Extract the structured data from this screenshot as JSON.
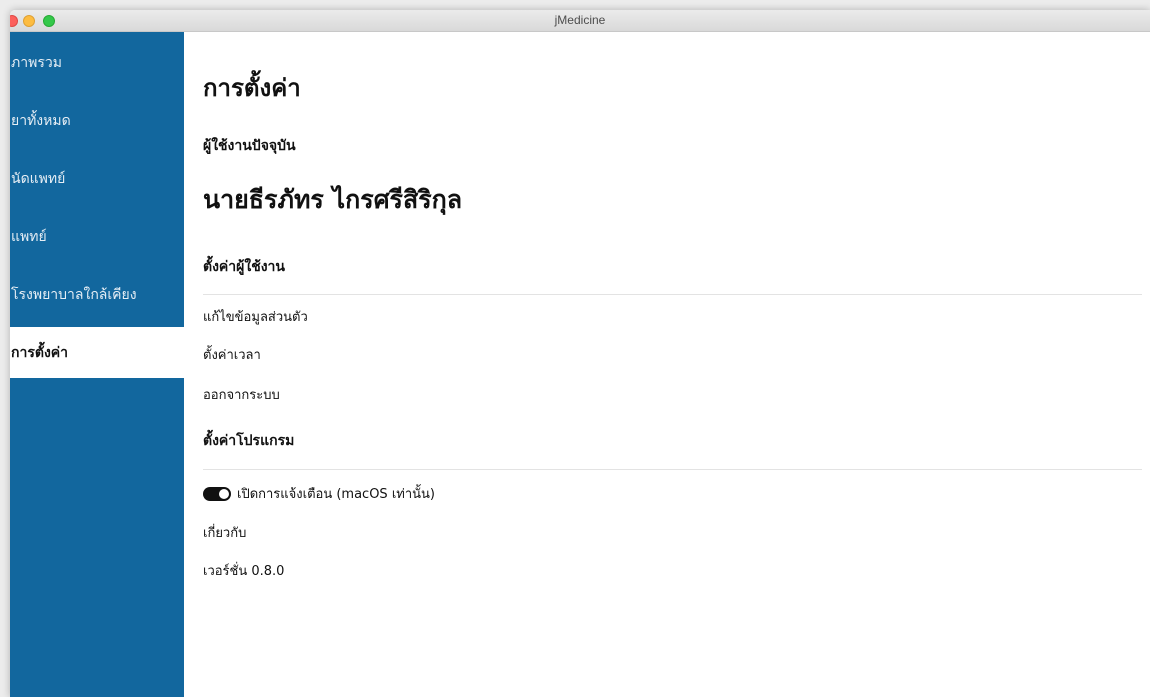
{
  "window": {
    "title": "jMedicine"
  },
  "sidebar": {
    "items": [
      {
        "label": "ภาพรวม"
      },
      {
        "label": "ยาทั้งหมด"
      },
      {
        "label": "นัดแพทย์"
      },
      {
        "label": "แพทย์"
      },
      {
        "label": "โรงพยาบาลใกล้เคียง"
      },
      {
        "label": "การตั้งค่า",
        "active": true
      }
    ]
  },
  "main": {
    "title": "การตั้งค่า",
    "current_user_label": "ผู้ใช้งานปัจจุบัน",
    "user_name": "นายธีรภัทร ไกรศรีสิริกุล",
    "user_settings": {
      "heading": "ตั้งค่าผู้ใช้งาน",
      "links": [
        "แก้ไขข้อมูลส่วนตัว",
        "ตั้งค่าเวลา",
        "ออกจากระบบ"
      ]
    },
    "program_settings": {
      "heading": "ตั้งค่าโปรแกรม",
      "notification_toggle": {
        "label": "เปิดการแจ้งเตือน (macOS เท่านั้น)",
        "state": "on"
      },
      "about_label": "เกี่ยวกับ",
      "version_text": "เวอร์ชั่น 0.8.0"
    }
  },
  "colors": {
    "sidebar_bg": "#12679e",
    "sidebar_active_bg": "#ffffff",
    "toggle_on": "#111111"
  }
}
